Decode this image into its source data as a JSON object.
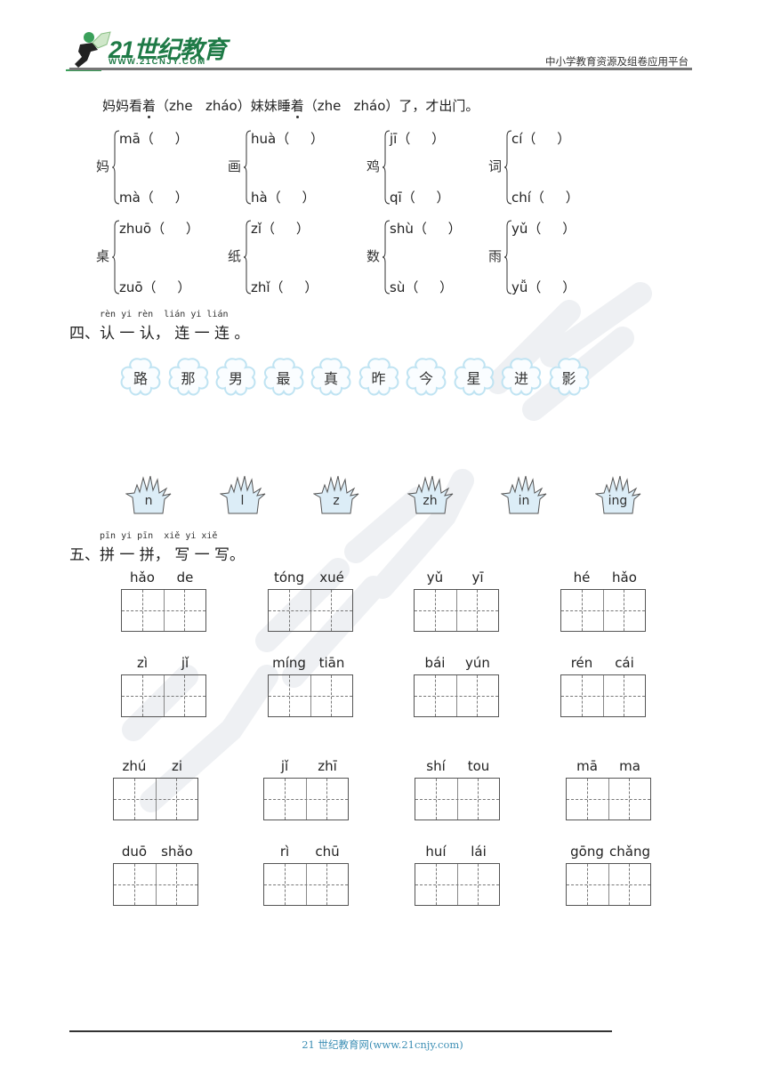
{
  "header": {
    "logo_text": "21世纪教育",
    "logo_url": "WWW.21CNJY.COM",
    "tagline": "中小学教育资源及组卷应用平台",
    "logo_color": "#1e7a46"
  },
  "section3": {
    "sentence_parts": [
      "妈妈看",
      "着",
      "（zhe   zháo）妹妹睡",
      "着",
      "（zhe   zháo）了，才出门。"
    ],
    "groups": [
      {
        "char": "妈",
        "top": "mā（     ）",
        "bottom": "mà（     ）"
      },
      {
        "char": "画",
        "top": "huà（     ）",
        "bottom": "hà（     ）"
      },
      {
        "char": "鸡",
        "top": "jī（     ）",
        "bottom": "qī（     ）"
      },
      {
        "char": "词",
        "top": "cí（     ）",
        "bottom": "chí（     ）"
      },
      {
        "char": "桌",
        "top": "zhuō（     ）",
        "bottom": "zuō（     ）"
      },
      {
        "char": "纸",
        "top": "zǐ（     ）",
        "bottom": "zhǐ（     ）"
      },
      {
        "char": "数",
        "top": "shù（     ）",
        "bottom": "sù（     ）"
      },
      {
        "char": "雨",
        "top": "yǔ（     ）",
        "bottom": "yǚ（     ）"
      }
    ]
  },
  "section4": {
    "pinyin": "rèn yi rèn  lián yi lián",
    "heading": "四、认 一 认， 连 一 连 。",
    "flowers": [
      "路",
      "那",
      "男",
      "最",
      "真",
      "昨",
      "今",
      "星",
      "进",
      "影"
    ],
    "grass": [
      "n",
      "l",
      "z",
      "zh",
      "in",
      "ing"
    ],
    "flower_color": "#bfe3f2",
    "grass_fill": "#dcedf7"
  },
  "section5": {
    "pinyin": "pīn yi pīn  xiě yi xiě",
    "heading": "五、拼 一 拼， 写 一 写。",
    "boxes": [
      [
        "hǎo",
        "de"
      ],
      [
        "tóng",
        "xué"
      ],
      [
        "yǔ",
        "yī"
      ],
      [
        "hé",
        "hǎo"
      ],
      [
        "zì",
        "jǐ"
      ],
      [
        "míng",
        "tiān"
      ],
      [
        "bái",
        "yún"
      ],
      [
        "rén",
        "cái"
      ],
      [
        "zhú",
        "zi"
      ],
      [
        "jǐ",
        "zhī"
      ],
      [
        "shí",
        "tou"
      ],
      [
        "mā",
        "ma"
      ],
      [
        "duō",
        "shǎo"
      ],
      [
        "rì",
        "chū"
      ],
      [
        "huí",
        "lái"
      ],
      [
        "gōng",
        "chǎng"
      ]
    ]
  },
  "footer": {
    "text": "21 世纪教育网(www.21cnjy.com)",
    "color": "#3d8fb5"
  }
}
